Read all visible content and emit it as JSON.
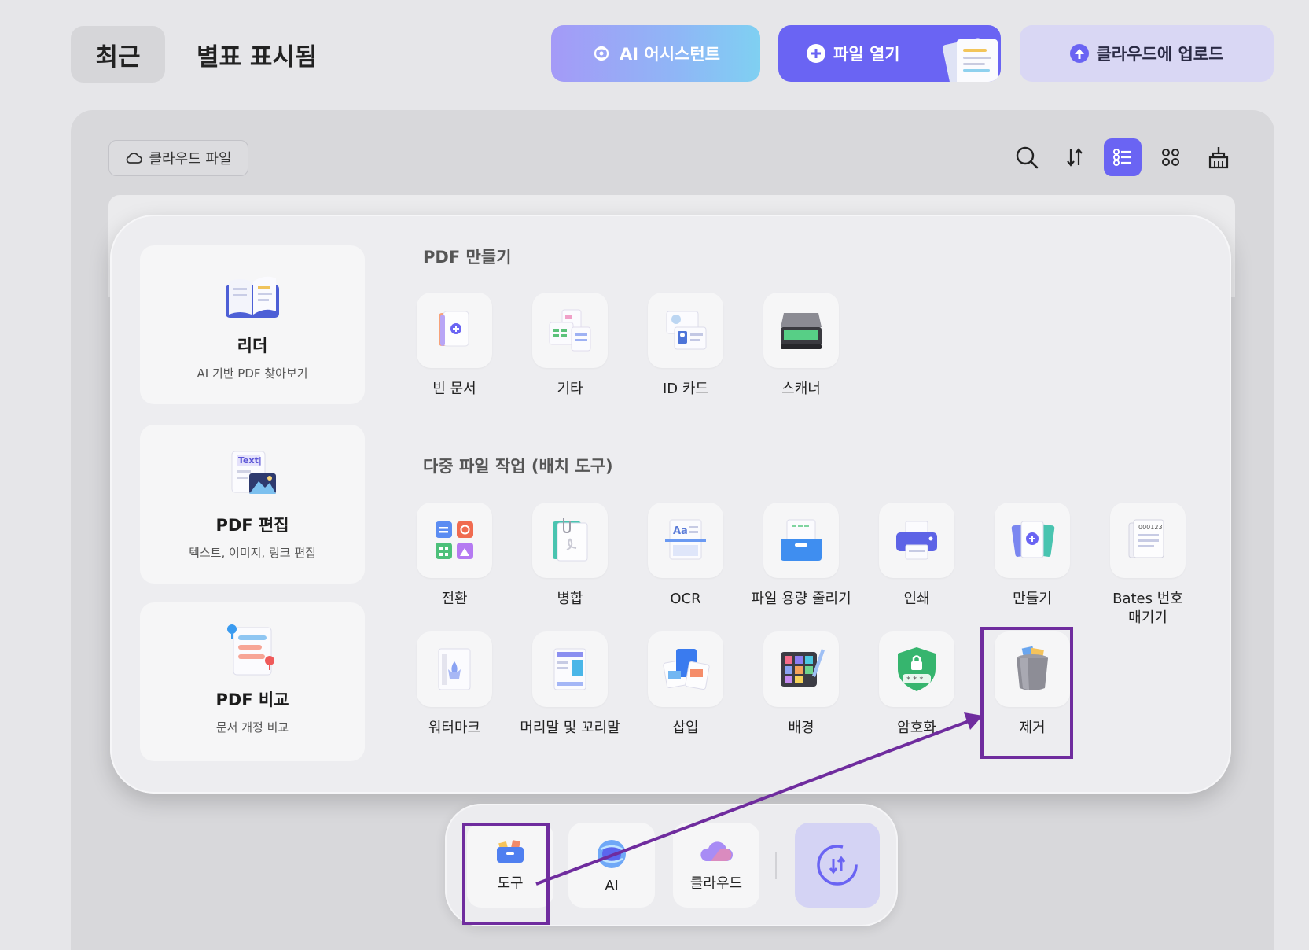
{
  "header": {
    "tab_recent": "최근",
    "tab_starred": "별표 표시됨",
    "ai_assistant_label": "AI 어시스턴트",
    "open_file_label": "파일 열기",
    "upload_label": "클라우드에 업로드"
  },
  "toolbar": {
    "cloud_files_label": "클라우드 파일",
    "icons": [
      "search-icon",
      "sort-icon",
      "list-view-icon",
      "grid-view-icon",
      "clean-icon"
    ]
  },
  "left_cards": [
    {
      "title": "리더",
      "subtitle": "AI 기반 PDF 찾아보기"
    },
    {
      "title": "PDF 편집",
      "subtitle": "텍스트, 이미지, 링크 편집"
    },
    {
      "title": "PDF 비교",
      "subtitle": "문서 개정 비교"
    }
  ],
  "create_section": {
    "title": "PDF 만들기",
    "tools": [
      "빈 문서",
      "기타",
      "ID 카드",
      "스캐너"
    ]
  },
  "batch_section": {
    "title": "다중 파일 작업 (배치 도구)",
    "tools_row1": [
      "전환",
      "병합",
      "OCR",
      "파일 용량 줄리기",
      "인쇄",
      "만들기",
      "Bates 번호 매기기"
    ],
    "tools_row2": [
      "워터마크",
      "머리말 및 꼬리말",
      "삽입",
      "배경",
      "암호화",
      "제거"
    ]
  },
  "dock": {
    "tools_label": "도구",
    "ai_label": "AI",
    "cloud_label": "클라우드"
  },
  "colors": {
    "accent": "#6a64f3",
    "highlight": "#6f2c9e",
    "background": "#e6e6e9"
  }
}
